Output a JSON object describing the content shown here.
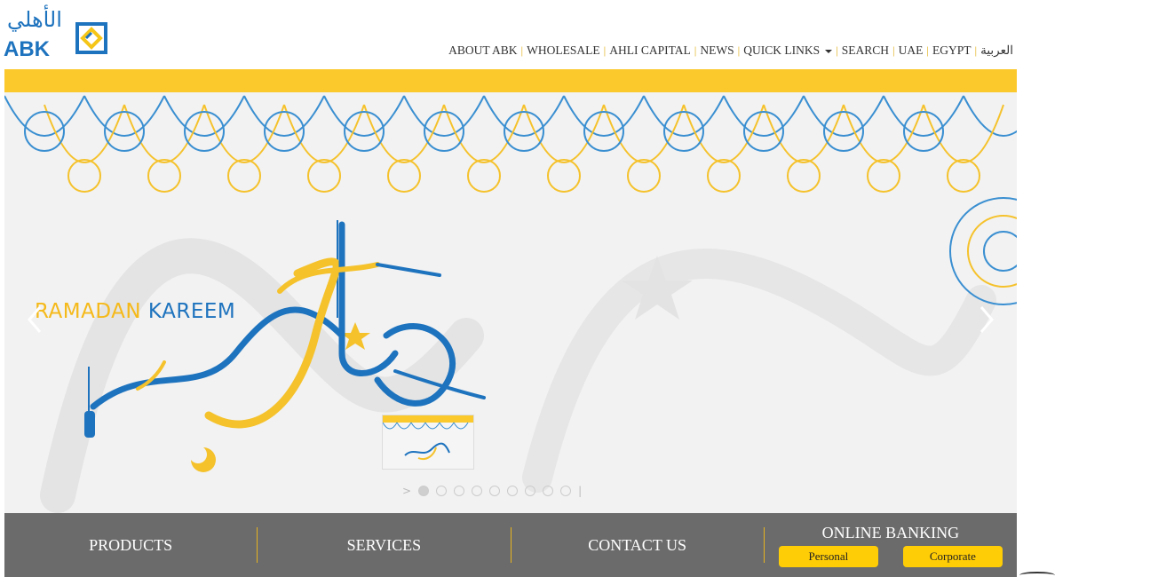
{
  "logo": {
    "arabic": "الأهلي",
    "english": "ABK",
    "brand_blue": "#1e73be",
    "brand_yellow": "#f5c518"
  },
  "topnav": {
    "items": [
      {
        "label": "ABOUT ABK"
      },
      {
        "label": "WHOLESALE"
      },
      {
        "label": "AHLI CAPITAL"
      },
      {
        "label": "NEWS"
      },
      {
        "label": "QUICK LINKS",
        "dropdown": true
      },
      {
        "label": "SEARCH"
      },
      {
        "label": "UAE"
      },
      {
        "label": "EGYPT"
      },
      {
        "label": "العربية"
      }
    ]
  },
  "hero": {
    "title_part1": "RAMADAN",
    "title_part2": "KAREEM",
    "arabic_calligraphy": "رمضان كريم",
    "left_arrow_icon": "chevron-left-icon",
    "right_arrow_icon": "chevron-right-icon",
    "slide_count": 9,
    "active_slide": 1,
    "prev_glyph": ">",
    "next_glyph": "|"
  },
  "bottombar": {
    "products": "PRODUCTS",
    "services": "SERVICES",
    "contact": "CONTACT US",
    "online_banking": {
      "title": "ONLINE BANKING",
      "personal": "Personal",
      "corporate": "Corporate"
    }
  },
  "colors": {
    "accent_yellow": "#fbc92b",
    "bar_gray": "#6b6b6b",
    "button_yellow": "#ffcd05"
  }
}
